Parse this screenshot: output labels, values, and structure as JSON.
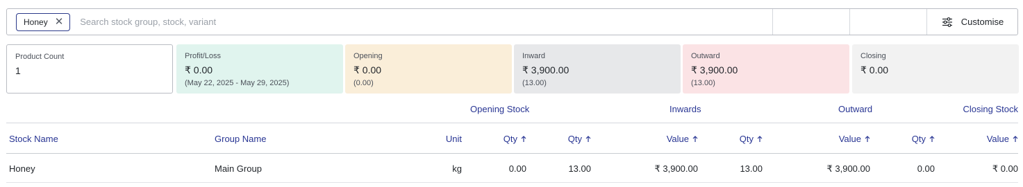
{
  "search": {
    "chip_label": "Honey",
    "placeholder": "Search stock group, stock, variant",
    "value": "",
    "customise_label": "Customise"
  },
  "cards": {
    "product_count": {
      "label": "Product Count",
      "value": "1"
    },
    "profit_loss": {
      "label": "Profit/Loss",
      "value": "₹ 0.00",
      "sub": "(May 22, 2025 - May 29, 2025)"
    },
    "opening": {
      "label": "Opening",
      "value": "₹ 0.00",
      "sub": "(0.00)"
    },
    "inward": {
      "label": "Inward",
      "value": "₹ 3,900.00",
      "sub": "(13.00)"
    },
    "outward": {
      "label": "Outward",
      "value": "₹ 3,900.00",
      "sub": "(13.00)"
    },
    "closing": {
      "label": "Closing",
      "value": "₹ 0.00"
    }
  },
  "colors": {
    "accent": "#283593",
    "profit_bg": "#e0f4ee",
    "opening_bg": "#faeed9",
    "inward_bg": "#e7e8ea",
    "outward_bg": "#fbe3e5",
    "closing_bg": "#f2f2f2"
  },
  "table": {
    "group_headers": {
      "opening": "Opening Stock",
      "inwards": "Inwards",
      "outward": "Outward",
      "closing": "Closing Stock"
    },
    "columns": {
      "stock_name": "Stock Name",
      "group_name": "Group Name",
      "unit": "Unit",
      "opening_qty": "Qty",
      "inward_qty": "Qty",
      "inward_value": "Value",
      "outward_qty": "Qty",
      "outward_value": "Value",
      "closing_qty": "Qty",
      "closing_value": "Value"
    },
    "rows": [
      {
        "stock_name": "Honey",
        "group_name": "Main Group",
        "unit": "kg",
        "opening_qty": "0.00",
        "inward_qty": "13.00",
        "inward_value": "₹ 3,900.00",
        "outward_qty": "13.00",
        "outward_value": "₹ 3,900.00",
        "closing_qty": "0.00",
        "closing_value": "₹ 0.00"
      }
    ]
  },
  "icons": {
    "chip_close": "close-icon",
    "customise": "sliders-icon",
    "sort": "arrow-up-icon"
  }
}
